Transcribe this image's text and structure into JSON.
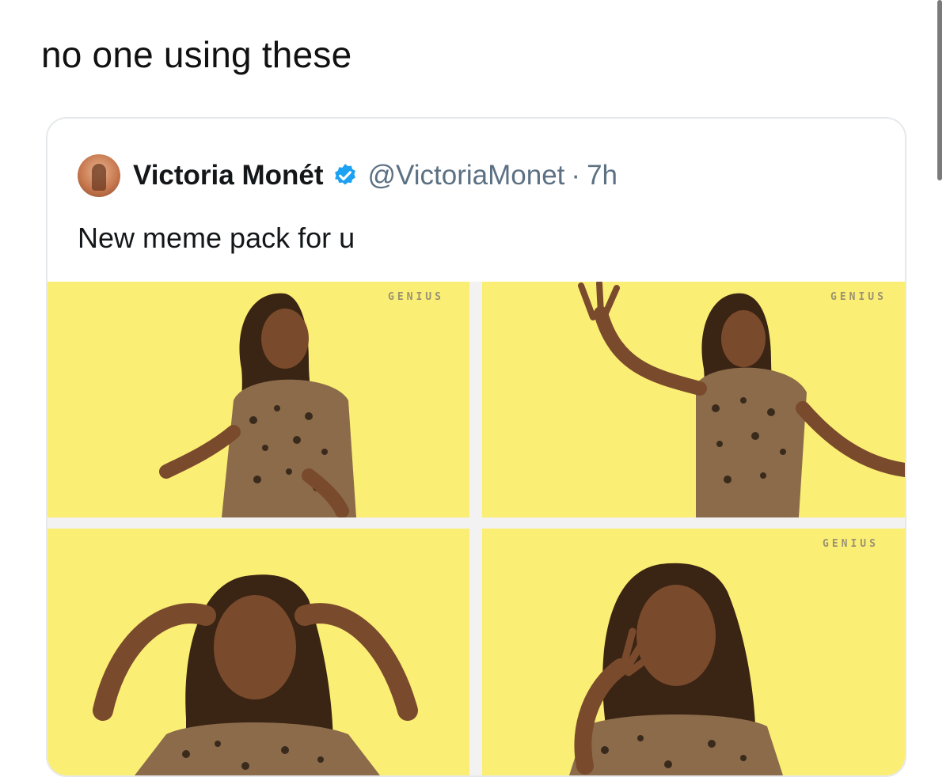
{
  "post": {
    "caption": "no one using these"
  },
  "tweet": {
    "author_name": "Victoria Monét",
    "verified": true,
    "handle": "@VictoriaMonet",
    "separator": "·",
    "time": "7h",
    "text": "New meme pack for u",
    "avatar_icon": "profile-photo",
    "verified_icon": "verified-badge-icon",
    "colors": {
      "verified_blue": "#1da1f2",
      "tile_background": "#fbee75"
    }
  },
  "media": {
    "watermark": "GENIUS",
    "tiles": [
      {
        "name": "meme-photo-1",
        "watermark_visible": true
      },
      {
        "name": "meme-photo-2",
        "watermark_visible": true
      },
      {
        "name": "meme-photo-3",
        "watermark_visible": false
      },
      {
        "name": "meme-photo-4",
        "watermark_visible": true
      }
    ]
  }
}
